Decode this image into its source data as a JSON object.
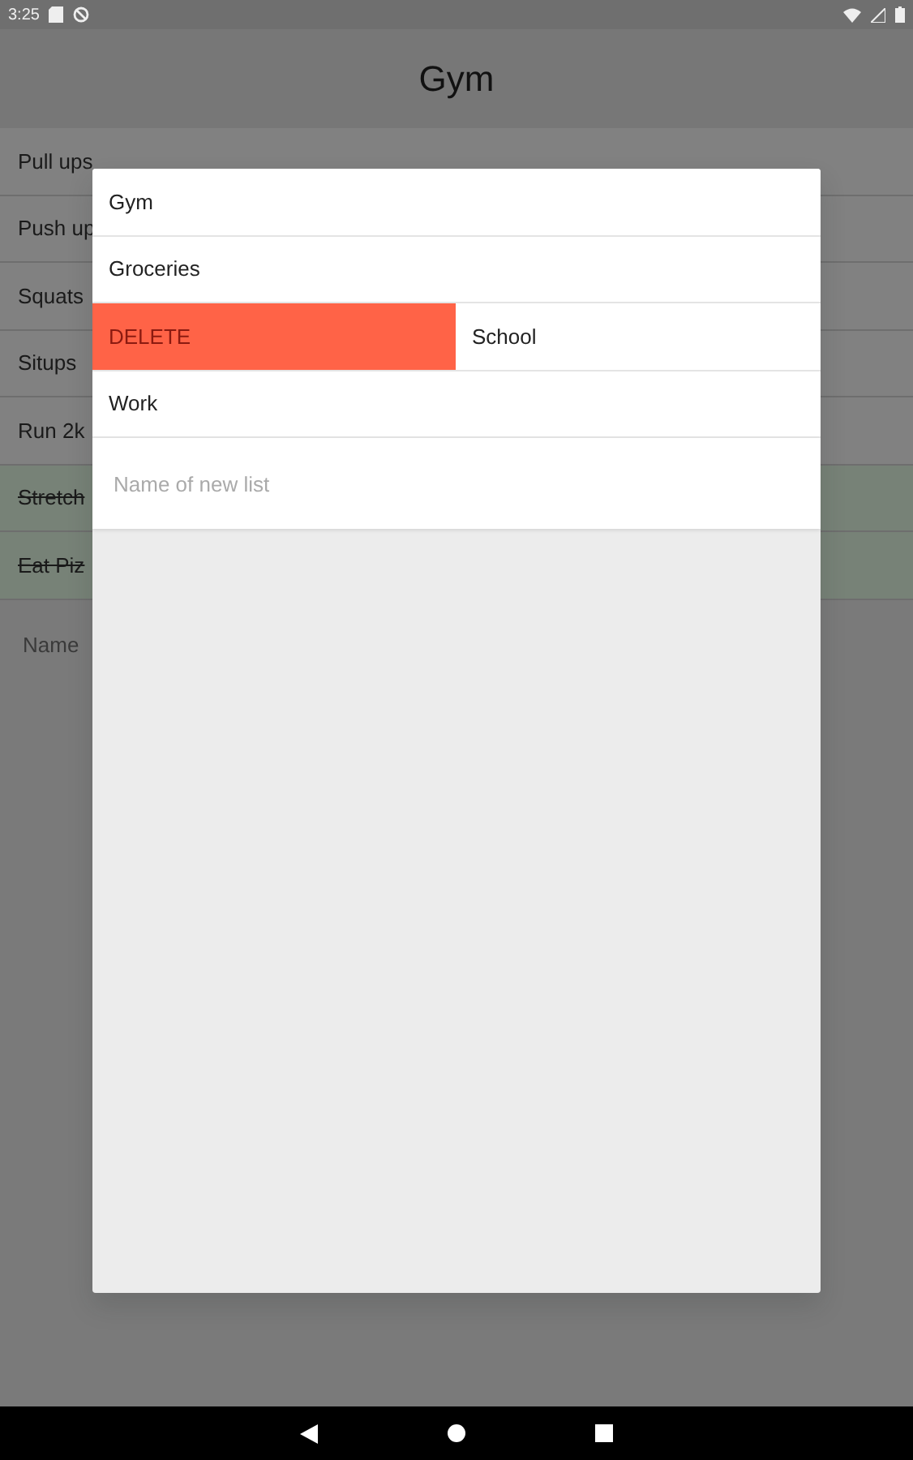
{
  "status_bar": {
    "time": "3:25"
  },
  "title": "Gym",
  "tasks": [
    {
      "text": "Pull ups",
      "done": false
    },
    {
      "text": "Push up",
      "done": false
    },
    {
      "text": "Squats",
      "done": false
    },
    {
      "text": "Situps",
      "done": false
    },
    {
      "text": "Run 2k",
      "done": false
    },
    {
      "text": "Stretch",
      "done": true
    },
    {
      "text": "Eat Piz",
      "done": true
    }
  ],
  "new_task": {
    "placeholder": "Name"
  },
  "lists_dialog": {
    "swipe_action": "DELETE",
    "lists": [
      {
        "name": "Gym",
        "swiped": false
      },
      {
        "name": "Groceries",
        "swiped": false
      },
      {
        "name": "School",
        "swiped": true
      },
      {
        "name": "Work",
        "swiped": false
      }
    ],
    "new_list": {
      "placeholder": "Name of new list"
    }
  }
}
